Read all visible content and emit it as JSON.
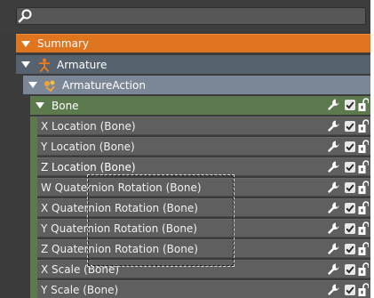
{
  "search": {
    "placeholder": "",
    "value": ""
  },
  "tree": {
    "summary": {
      "label": "Summary"
    },
    "armature": {
      "label": "Armature"
    },
    "action": {
      "label": "ArmatureAction"
    },
    "group": {
      "label": "Bone"
    },
    "channels": [
      {
        "label": "X Location (Bone)",
        "selected": false
      },
      {
        "label": "Y Location (Bone)",
        "selected": false
      },
      {
        "label": "Z Location (Bone)",
        "selected": true
      },
      {
        "label": "W Quaternion Rotation (Bone)",
        "selected": false
      },
      {
        "label": "X Quaternion Rotation (Bone)",
        "selected": false
      },
      {
        "label": "Y Quaternion Rotation (Bone)",
        "selected": false
      },
      {
        "label": "Z Quaternion Rotation (Bone)",
        "selected": false
      },
      {
        "label": "X Scale (Bone)",
        "selected": false
      },
      {
        "label": "Y Scale (Bone)",
        "selected": false
      }
    ]
  },
  "icons": {
    "search": "magnifier-icon",
    "armature": "armature-icon",
    "action": "action-icon",
    "modifier": "wrench-icon",
    "mute": "checkbox-icon",
    "lock": "lock-icon"
  },
  "colors": {
    "summary": "#e0751f",
    "armature": "#56626e",
    "action": "#7b8796",
    "group": "#5c7a4d",
    "channel": "#5f5f5f",
    "panel": "#3b3b3b"
  }
}
